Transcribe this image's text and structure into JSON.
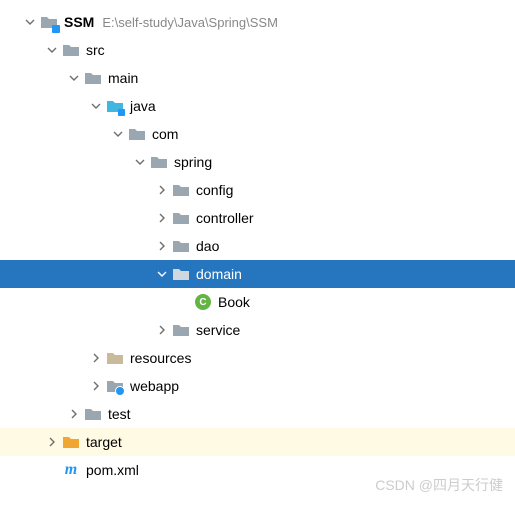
{
  "root": {
    "name": "SSM",
    "path": "E:\\self-study\\Java\\Spring\\SSM"
  },
  "tree": {
    "src": "src",
    "main": "main",
    "java": "java",
    "com": "com",
    "spring": "spring",
    "config": "config",
    "controller": "controller",
    "dao": "dao",
    "domain": "domain",
    "book": "Book",
    "service": "service",
    "resources": "resources",
    "webapp": "webapp",
    "test": "test",
    "target": "target",
    "pom": "pom.xml"
  },
  "watermark": "CSDN @四月天行健",
  "colors": {
    "selection": "#2675bf",
    "highlight": "#fffae3",
    "folder_gray": "#9aa7b0",
    "folder_blue": "#40b6e0",
    "folder_orange": "#f0a732",
    "class_green": "#62b543"
  }
}
